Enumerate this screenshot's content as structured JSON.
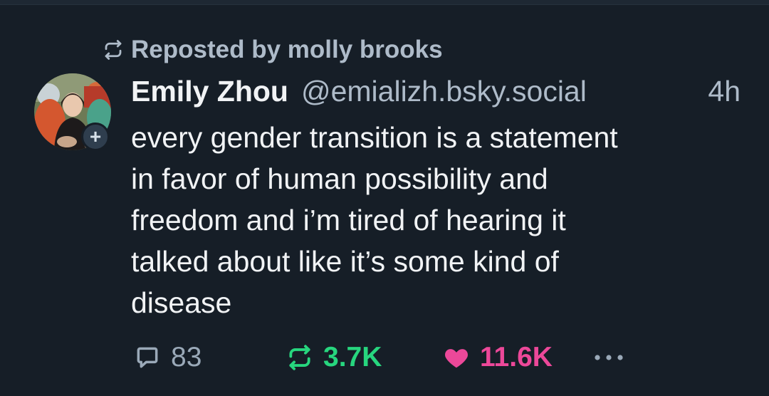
{
  "repost": {
    "label": "Reposted by molly brooks",
    "icon": "repost-icon"
  },
  "author": {
    "display_name": "Emily Zhou",
    "handle": "@emializh.bsky.social",
    "avatar_icon": "avatar-image",
    "follow_badge": "+"
  },
  "timestamp": "4h",
  "post": {
    "text": "every gender transition is a statement\nin favor of human possibility and\nfreedom and i’m tired of hearing it\ntalked about like it’s some kind of\ndisease"
  },
  "actions": {
    "reply": {
      "icon": "comment-icon",
      "count": "83"
    },
    "repost": {
      "icon": "repost-icon",
      "count": "3.7K",
      "color": "#27d67e"
    },
    "like": {
      "icon": "heart-icon",
      "count": "11.6K",
      "color": "#ec4899"
    },
    "more": {
      "icon": "more-icon"
    }
  },
  "colors": {
    "background": "#161e27",
    "text_primary": "#f1f3f5",
    "text_secondary": "#aebbc9"
  }
}
